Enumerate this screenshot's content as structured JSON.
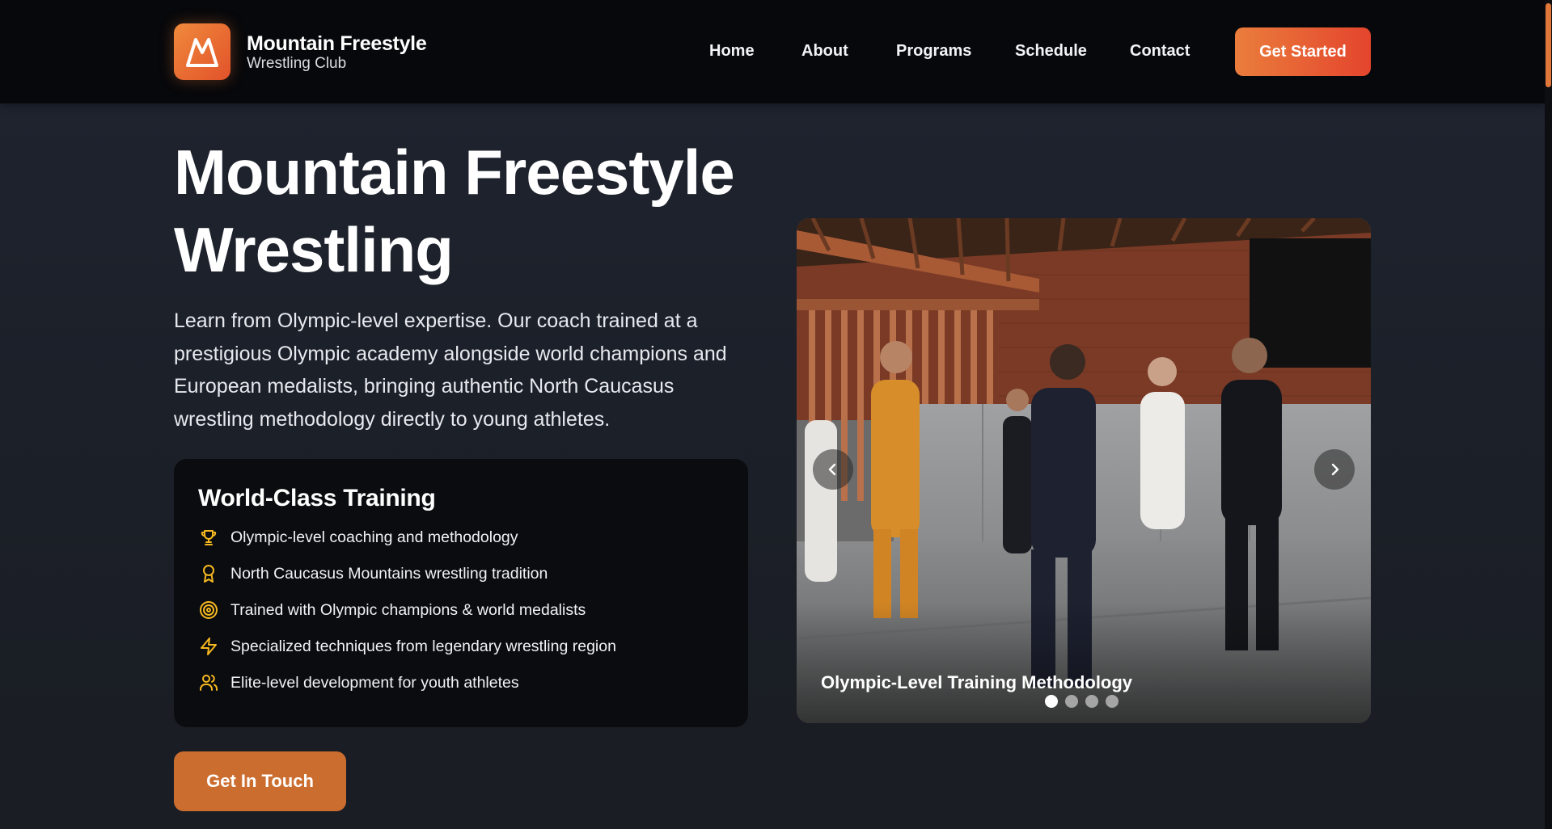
{
  "brand": {
    "title": "Mountain Freestyle",
    "subtitle": "Wrestling Club"
  },
  "nav": {
    "items": [
      {
        "label": "Home"
      },
      {
        "label": "About"
      },
      {
        "label": "Programs"
      },
      {
        "label": "Schedule"
      },
      {
        "label": "Contact"
      }
    ],
    "cta": "Get Started"
  },
  "hero": {
    "title_line1": "Mountain Freestyle",
    "title_line2": "Wrestling",
    "description": "Learn from Olympic-level expertise. Our coach trained at a prestigious Olympic academy alongside world champions and European medalists, bringing authentic North Caucasus wrestling methodology directly to young athletes.",
    "cta": "Get In Touch"
  },
  "card": {
    "title": "World-Class Training",
    "features": [
      {
        "icon": "trophy-icon",
        "text": "Olympic-level coaching and methodology"
      },
      {
        "icon": "medal-icon",
        "text": "North Caucasus Mountains wrestling tradition"
      },
      {
        "icon": "target-icon",
        "text": "Trained with Olympic champions & world medalists"
      },
      {
        "icon": "lightning-icon",
        "text": "Specialized techniques from legendary wrestling region"
      },
      {
        "icon": "users-icon",
        "text": "Elite-level development for youth athletes"
      }
    ]
  },
  "carousel": {
    "caption": "Olympic-Level Training Methodology",
    "slide_count": 4,
    "active_slide": 1
  },
  "colors": {
    "accent": "#e2522a",
    "accent_light": "#f08a3c",
    "icon_gold": "#f5b820",
    "header_bg": "#07080b",
    "card_bg": "#0b0c0f"
  }
}
